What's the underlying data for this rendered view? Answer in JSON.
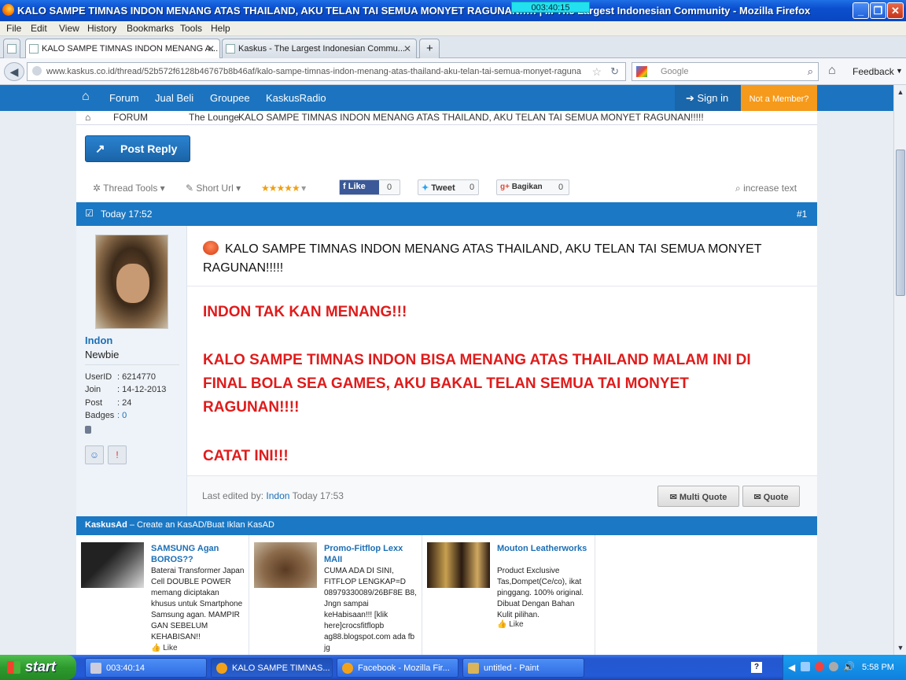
{
  "window": {
    "title": "KALO SAMPE TIMNAS INDON MENANG ATAS THAILAND, AKU TELAN TAI SEMUA MONYET RAGUNAN!!!!! | ... The Largest Indonesian Community - Mozilla Firefox",
    "timer_overlay": "003:40:15",
    "minimize": "_",
    "maximize": "❐",
    "close": "✕"
  },
  "menu": [
    "File",
    "Edit",
    "View",
    "History",
    "Bookmarks",
    "Tools",
    "Help"
  ],
  "tabs": [
    {
      "label": "KALO SAMPE TIMNAS INDON MENANG A...",
      "close": "✕"
    },
    {
      "label": "Kaskus - The Largest Indonesian Commu...",
      "close": "✕"
    }
  ],
  "new_tab": "+",
  "nav": {
    "url": "www.kaskus.co.id/thread/52b572f6128b46767b8b46af/kalo-sampe-timnas-indon-menang-atas-thailand-aku-telan-tai-semua-monyet-raguna",
    "search_placeholder": "Google",
    "feedback": "Feedback"
  },
  "site": {
    "nav_items": [
      "Forum",
      "Jual Beli",
      "Groupee",
      "KaskusRadio"
    ],
    "sign_in": "Sign in",
    "not_member": "Not a Member?",
    "breadcrumb": [
      "FORUM",
      "The Lounge",
      "KALO SAMPE TIMNAS INDON MENANG ATAS THAILAND, AKU TELAN TAI SEMUA MONYET RAGUNAN!!!!!"
    ]
  },
  "thread": {
    "post_reply": "Post Reply",
    "tools": {
      "thread_tools": "Thread Tools",
      "short_url": "Short Url",
      "like": "Like",
      "like_count": "0",
      "tweet": "Tweet",
      "tweet_count": "0",
      "bagikan": "Bagikan",
      "bagikan_count": "0",
      "increase_text": "increase text"
    },
    "post_time": "Today 17:52",
    "post_number": "#1",
    "user": {
      "name": "Indon",
      "rank": "Newbie",
      "fields": [
        {
          "label": "UserID",
          "value": ": 6214770"
        },
        {
          "label": "Join",
          "value": ": 14-12-2013"
        },
        {
          "label": "Post",
          "value": ": 24"
        },
        {
          "label": "Badges",
          "value": ": 0"
        }
      ]
    },
    "title": "KALO SAMPE TIMNAS INDON MENANG ATAS THAILAND, AKU TELAN TAI SEMUA MONYET RAGUNAN!!!!!",
    "body": {
      "line1": "INDON TAK KAN MENANG!!!",
      "line2a": "KALO SAMPE TIMNAS INDON BISA MENANG ATAS THAILAND MALAM INI DI",
      "line2b": "FINAL BOLA SEA GAMES, AKU BAKAL TELAN SEMUA TAI MONYET",
      "line2c": "RAGUNAN!!!!",
      "line3": "CATAT INI!!!"
    },
    "last_edited_prefix": "Last edited by:",
    "last_edited_user": "Indon",
    "last_edited_time": "Today 17:53",
    "multi_quote": "Multi Quote",
    "quote": "Quote"
  },
  "ads": {
    "header": "KaskusAd",
    "header_sub": "– Create an KasAD/Buat Iklan KasAD",
    "items": [
      {
        "title": "SAMSUNG Agan BOROS??",
        "desc": "Baterai Transformer Japan Cell DOUBLE POWER memang diciptakan khusus untuk Smartphone Samsung agan. MAMPIR GAN SEBELUM KEHABISAN!!",
        "like": "Like"
      },
      {
        "title": "Promo-Fitflop Lexx MAII",
        "desc": "CUMA ADA DI SINI, FITFLOP LENGKAP=D 08979330089/26BF8E B8, Jngn sampai keHabisaan!!! [klik here]crocsfitflopb ag88.blogspot.com ada fb jg",
        "like": "Like"
      },
      {
        "title": "Mouton Leatherworks",
        "desc": "Product Exclusive Tas,Dompet(Ce/co), ikat pinggang. 100% original. Dibuat Dengan Bahan Kulit pilihan.",
        "like": "Like"
      }
    ]
  },
  "taskbar": {
    "start": "start",
    "tasks": [
      "003:40:14",
      "KALO SAMPE TIMNAS...",
      "Facebook - Mozilla Fir...",
      "untitled - Paint"
    ],
    "clock": "5:58 PM"
  },
  "colors": {
    "site_blue": "#1c74c0",
    "red_text": "#e01b1b",
    "member_orange": "#f59a1b"
  }
}
